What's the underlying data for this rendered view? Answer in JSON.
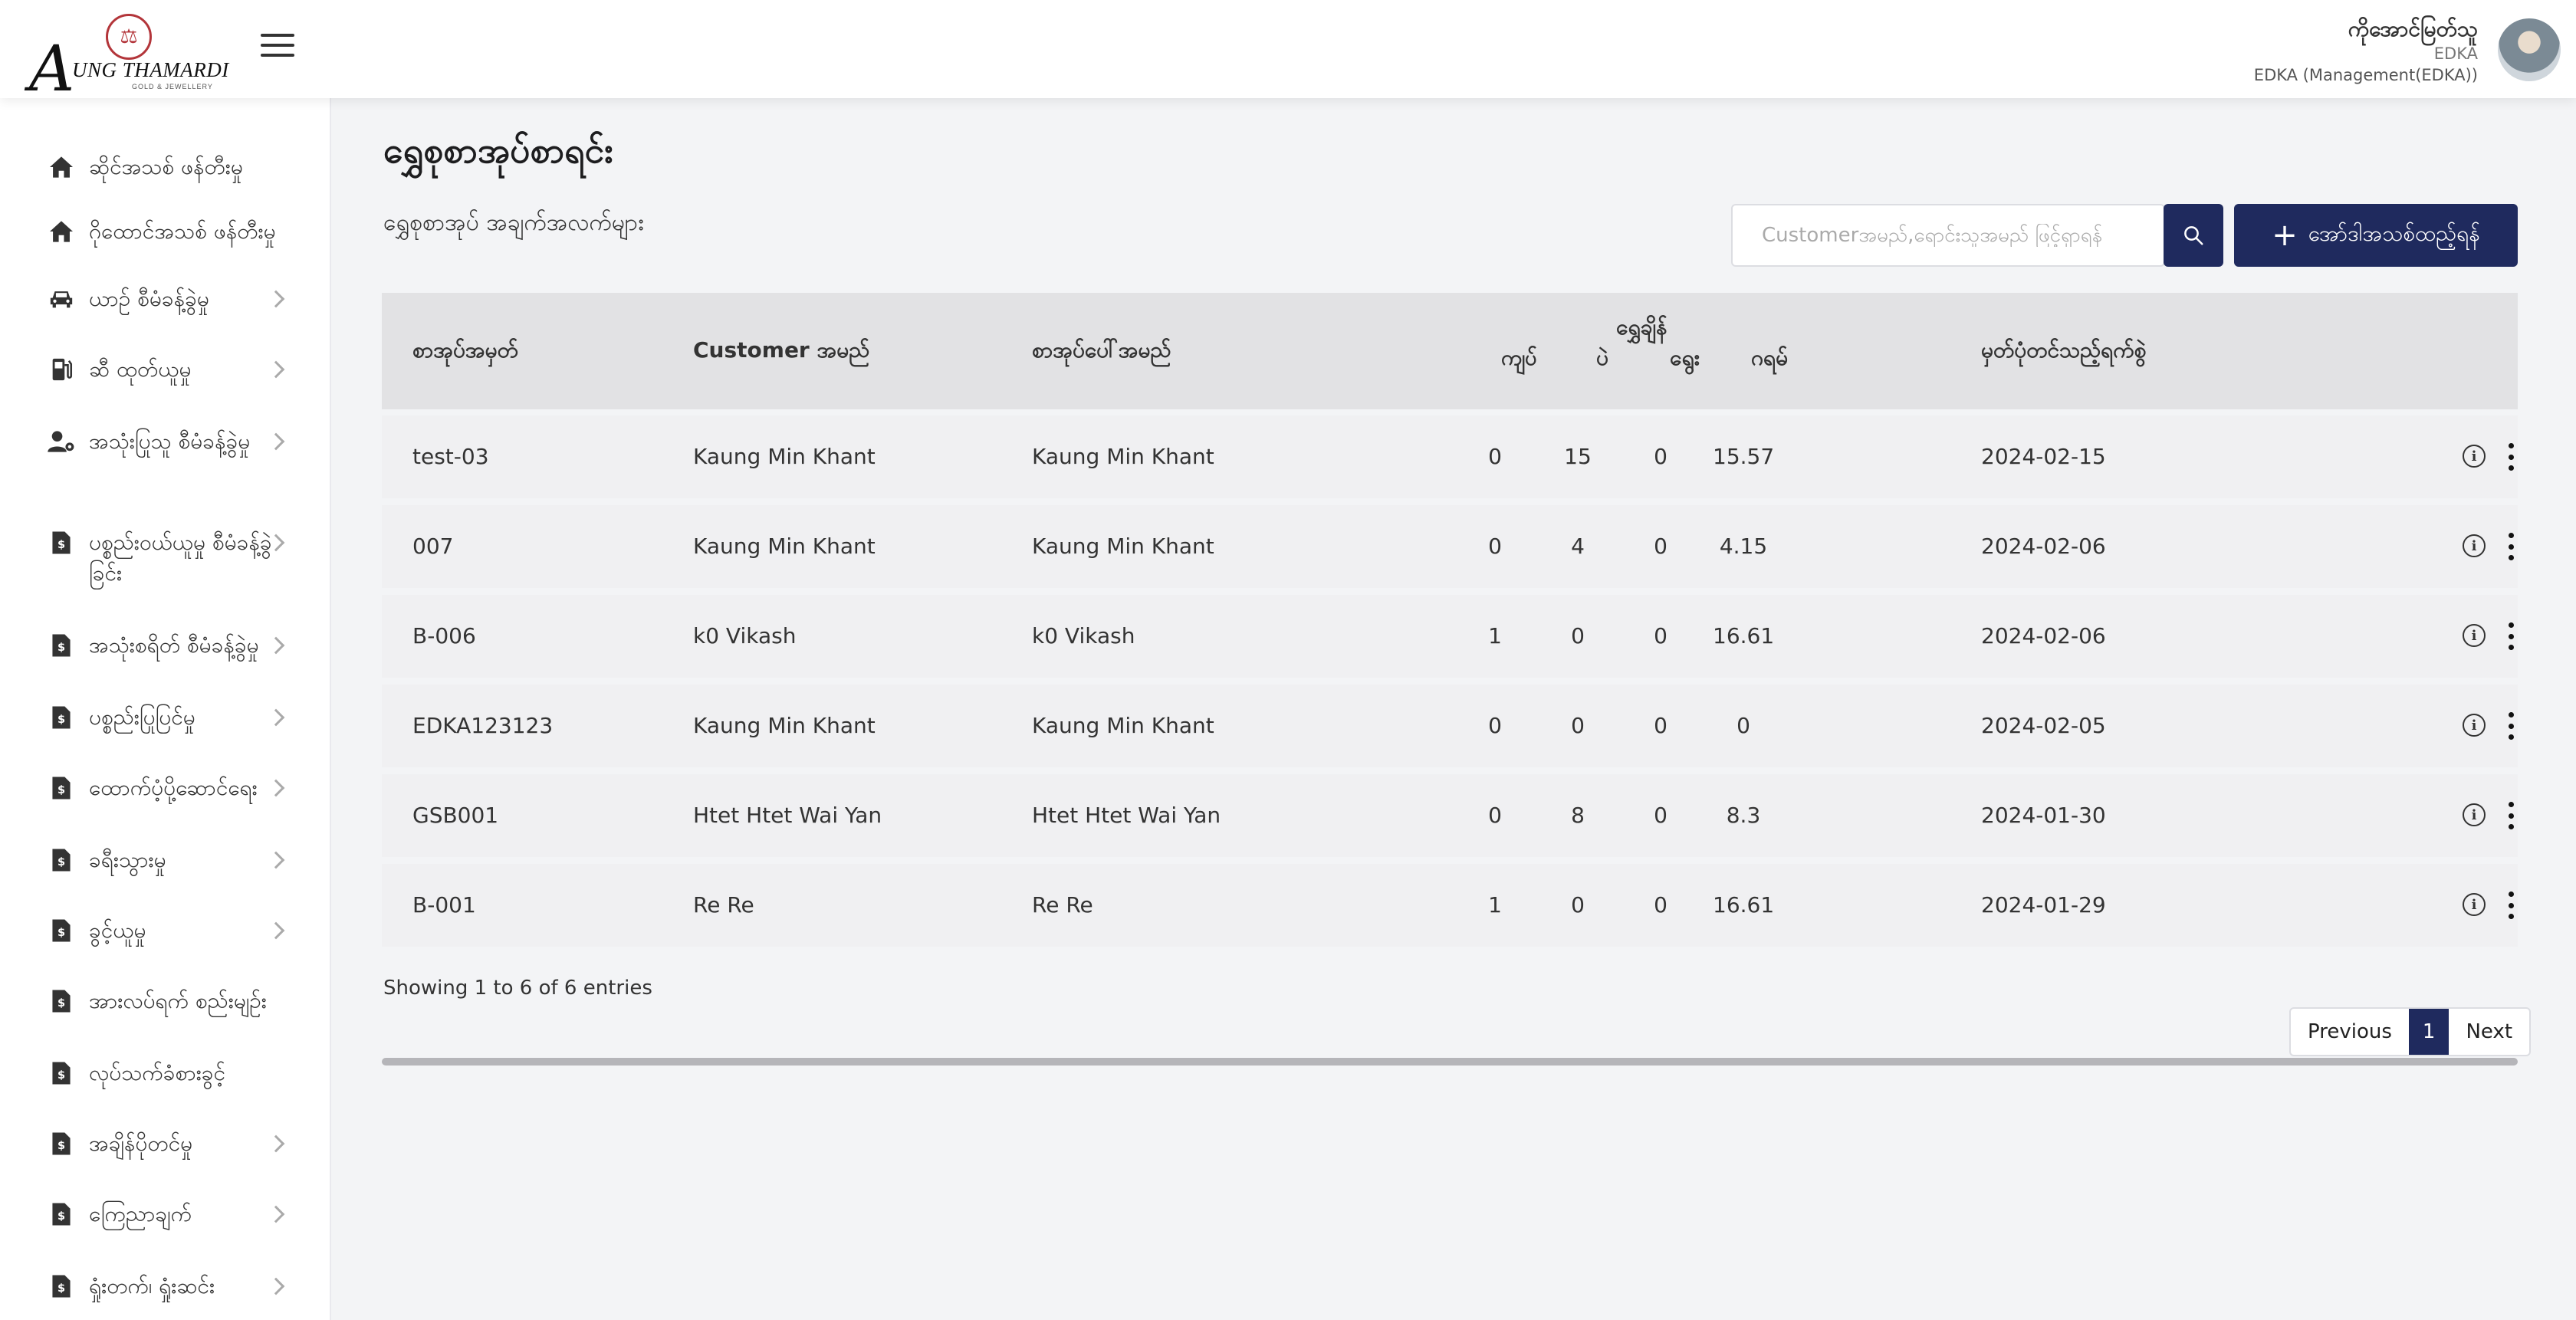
{
  "header": {
    "logo_text": "UNG THAMARDI",
    "logo_sub": "GOLD & JEWELLERY",
    "user_name": "ကိုအောင်မြတ်သူ",
    "user_org": "EDKA",
    "user_role": "EDKA (Management(EDKA))"
  },
  "sidebar": {
    "items": [
      {
        "label": "ဆိုင်အသစ် ဖန်တီးမှု",
        "icon": "home-icon",
        "chevron": false
      },
      {
        "label": "ဂိုထောင်အသစ် ဖန်တီးမှု",
        "icon": "home-icon",
        "chevron": false
      },
      {
        "label": "ယာဥ် စီမံခန့်ခွဲမှု",
        "icon": "car-icon",
        "chevron": true
      },
      {
        "label": "ဆီ ထုတ်ယူမှု",
        "icon": "fuel-icon",
        "chevron": true
      },
      {
        "label": "အသုံးပြုသူ စီမံခန့်ခွဲမှု",
        "icon": "user-gear-icon",
        "chevron": true
      },
      {
        "label": "ပစ္စည်းဝယ်ယူမှု စီမံခန့်ခွဲခြင်း",
        "icon": "invoice-icon",
        "chevron": true
      },
      {
        "label": "အသုံးစရိတ် စီမံခန့်ခွဲမှု",
        "icon": "invoice-icon",
        "chevron": true
      },
      {
        "label": "ပစ္စည်းပြုပြင်မှု",
        "icon": "invoice-icon",
        "chevron": true
      },
      {
        "label": "ထောက်ပံ့ပို့ဆောင်ရေး",
        "icon": "invoice-icon",
        "chevron": true
      },
      {
        "label": "ခရီးသွားမှု",
        "icon": "invoice-icon",
        "chevron": true
      },
      {
        "label": "ခွင့်ယူမှု",
        "icon": "invoice-icon",
        "chevron": true
      },
      {
        "label": "အားလပ်ရက် စည်းမျဥ်း",
        "icon": "invoice-icon",
        "chevron": false
      },
      {
        "label": "လုပ်သက်ခံစားခွင့်",
        "icon": "invoice-icon",
        "chevron": false
      },
      {
        "label": "အချိန်ပိုတင်မှု",
        "icon": "invoice-icon",
        "chevron": true
      },
      {
        "label": "ကြေညာချက်",
        "icon": "invoice-icon",
        "chevron": true
      },
      {
        "label": "ရှုံးတက်၊ ရှုံးဆင်း",
        "icon": "invoice-icon",
        "chevron": true
      }
    ]
  },
  "main": {
    "title": "ရွှေစုစာအုပ်စာရင်း",
    "subtitle": "ရွှေစုစာအုပ် အချက်အလက်များ",
    "search_placeholder": "Customerအမည်,ရောင်းသူအမည် ဖြင့်ရှာရန်",
    "add_button_label": "အော်ဒါအသစ်ထည့်ရန်"
  },
  "table": {
    "headers": {
      "book_no": "စာအုပ်အမှတ်",
      "customer": "Customer အမည်",
      "owner": "စာအုပ်ပေါ်အမည်",
      "weight_group": "ရွှေချိန်",
      "kyat": "ကျပ်",
      "pae": "ပဲ",
      "yway": "ရွေး",
      "gram": "ဂရမ်",
      "date": "မှတ်ပုံတင်သည့်ရက်စွဲ"
    },
    "rows": [
      {
        "book_no": "test-03",
        "customer": "Kaung Min Khant",
        "owner": "Kaung Min Khant",
        "kyat": "0",
        "pae": "15",
        "yway": "0",
        "gram": "15.57",
        "date": "2024-02-15"
      },
      {
        "book_no": "007",
        "customer": "Kaung Min Khant",
        "owner": "Kaung Min Khant",
        "kyat": "0",
        "pae": "4",
        "yway": "0",
        "gram": "4.15",
        "date": "2024-02-06"
      },
      {
        "book_no": "B-006",
        "customer": "k0 Vikash",
        "owner": "k0 Vikash",
        "kyat": "1",
        "pae": "0",
        "yway": "0",
        "gram": "16.61",
        "date": "2024-02-06"
      },
      {
        "book_no": "EDKA123123",
        "customer": "Kaung Min Khant",
        "owner": "Kaung Min Khant",
        "kyat": "0",
        "pae": "0",
        "yway": "0",
        "gram": "0",
        "date": "2024-02-05"
      },
      {
        "book_no": "GSB001",
        "customer": "Htet Htet Wai Yan",
        "owner": "Htet Htet Wai Yan",
        "kyat": "0",
        "pae": "8",
        "yway": "0",
        "gram": "8.3",
        "date": "2024-01-30"
      },
      {
        "book_no": "B-001",
        "customer": "Re Re",
        "owner": "Re Re",
        "kyat": "1",
        "pae": "0",
        "yway": "0",
        "gram": "16.61",
        "date": "2024-01-29"
      }
    ]
  },
  "pagination": {
    "info": "Showing 1 to 6 of 6 entries",
    "previous": "Previous",
    "current": "1",
    "next": "Next"
  },
  "colors": {
    "accent": "#1f2a5e",
    "row_bg": "#f0f0f2",
    "header_bg": "#e2e2e4"
  }
}
